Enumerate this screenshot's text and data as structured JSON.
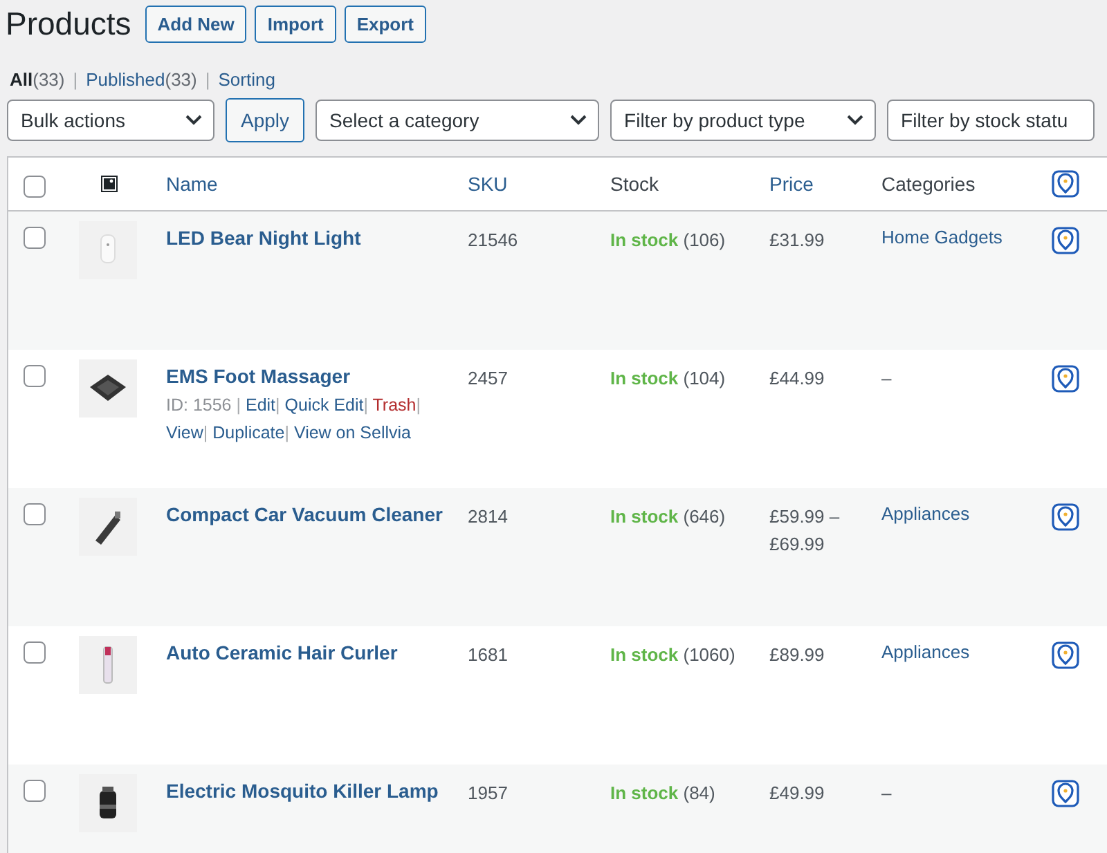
{
  "page": {
    "title": "Products",
    "buttons": [
      "Add New",
      "Import",
      "Export"
    ]
  },
  "views": {
    "separator": "|",
    "items": [
      {
        "label": "All",
        "count": "(33)",
        "selected": true
      },
      {
        "label": "Published",
        "count": "(33)",
        "selected": false
      },
      {
        "label": "Sorting",
        "selected": false
      }
    ]
  },
  "filters": {
    "bulk_actions": "Bulk actions",
    "apply": "Apply",
    "dropdowns": [
      "Select a category",
      "Filter by product type",
      "Filter by stock statu"
    ]
  },
  "table": {
    "select_all_checked": false,
    "columns": {
      "name": "Name",
      "sku": "SKU",
      "stock": "Stock",
      "price": "Price",
      "categories": "Categories"
    },
    "rows": [
      {
        "name": "LED Bear Night Light",
        "sku": "21546",
        "stock_status": "In stock",
        "stock_count": "(106)",
        "price": "£31.99",
        "category": {
          "kind": "link",
          "text": "Home Gadgets"
        },
        "checked": false
      },
      {
        "name": "EMS Foot Massager",
        "sku": "2457",
        "stock_status": "In stock",
        "stock_count": "(104)",
        "price": "£44.99",
        "category": {
          "kind": "none",
          "text": "–"
        },
        "checked": false,
        "row_actions": {
          "id": "ID: 1556",
          "separator": "|",
          "items": [
            {
              "label": "Edit",
              "kind": "link"
            },
            {
              "label": "Quick Edit",
              "kind": "link"
            },
            {
              "label": "Trash",
              "kind": "danger"
            },
            {
              "label": "View",
              "kind": "link"
            },
            {
              "label": "Duplicate",
              "kind": "link"
            },
            {
              "label": "View on Sellvia",
              "kind": "link"
            }
          ]
        }
      },
      {
        "name": "Compact Car Vacuum Cleaner",
        "sku": "2814",
        "stock_status": "In stock",
        "stock_count": "(646)",
        "price": "£59.99 – £69.99",
        "category": {
          "kind": "link",
          "text": "Appliances"
        },
        "checked": false
      },
      {
        "name": "Auto Ceramic Hair Curler",
        "sku": "1681",
        "stock_status": "In stock",
        "stock_count": "(1060)",
        "price": "£89.99",
        "category": {
          "kind": "link",
          "text": "Appliances"
        },
        "checked": false
      },
      {
        "name": "Electric Mosquito Killer Lamp",
        "sku": "1957",
        "stock_status": "In stock",
        "stock_count": "(84)",
        "price": "£49.99",
        "category": {
          "kind": "none",
          "text": "–"
        },
        "checked": false
      }
    ]
  }
}
